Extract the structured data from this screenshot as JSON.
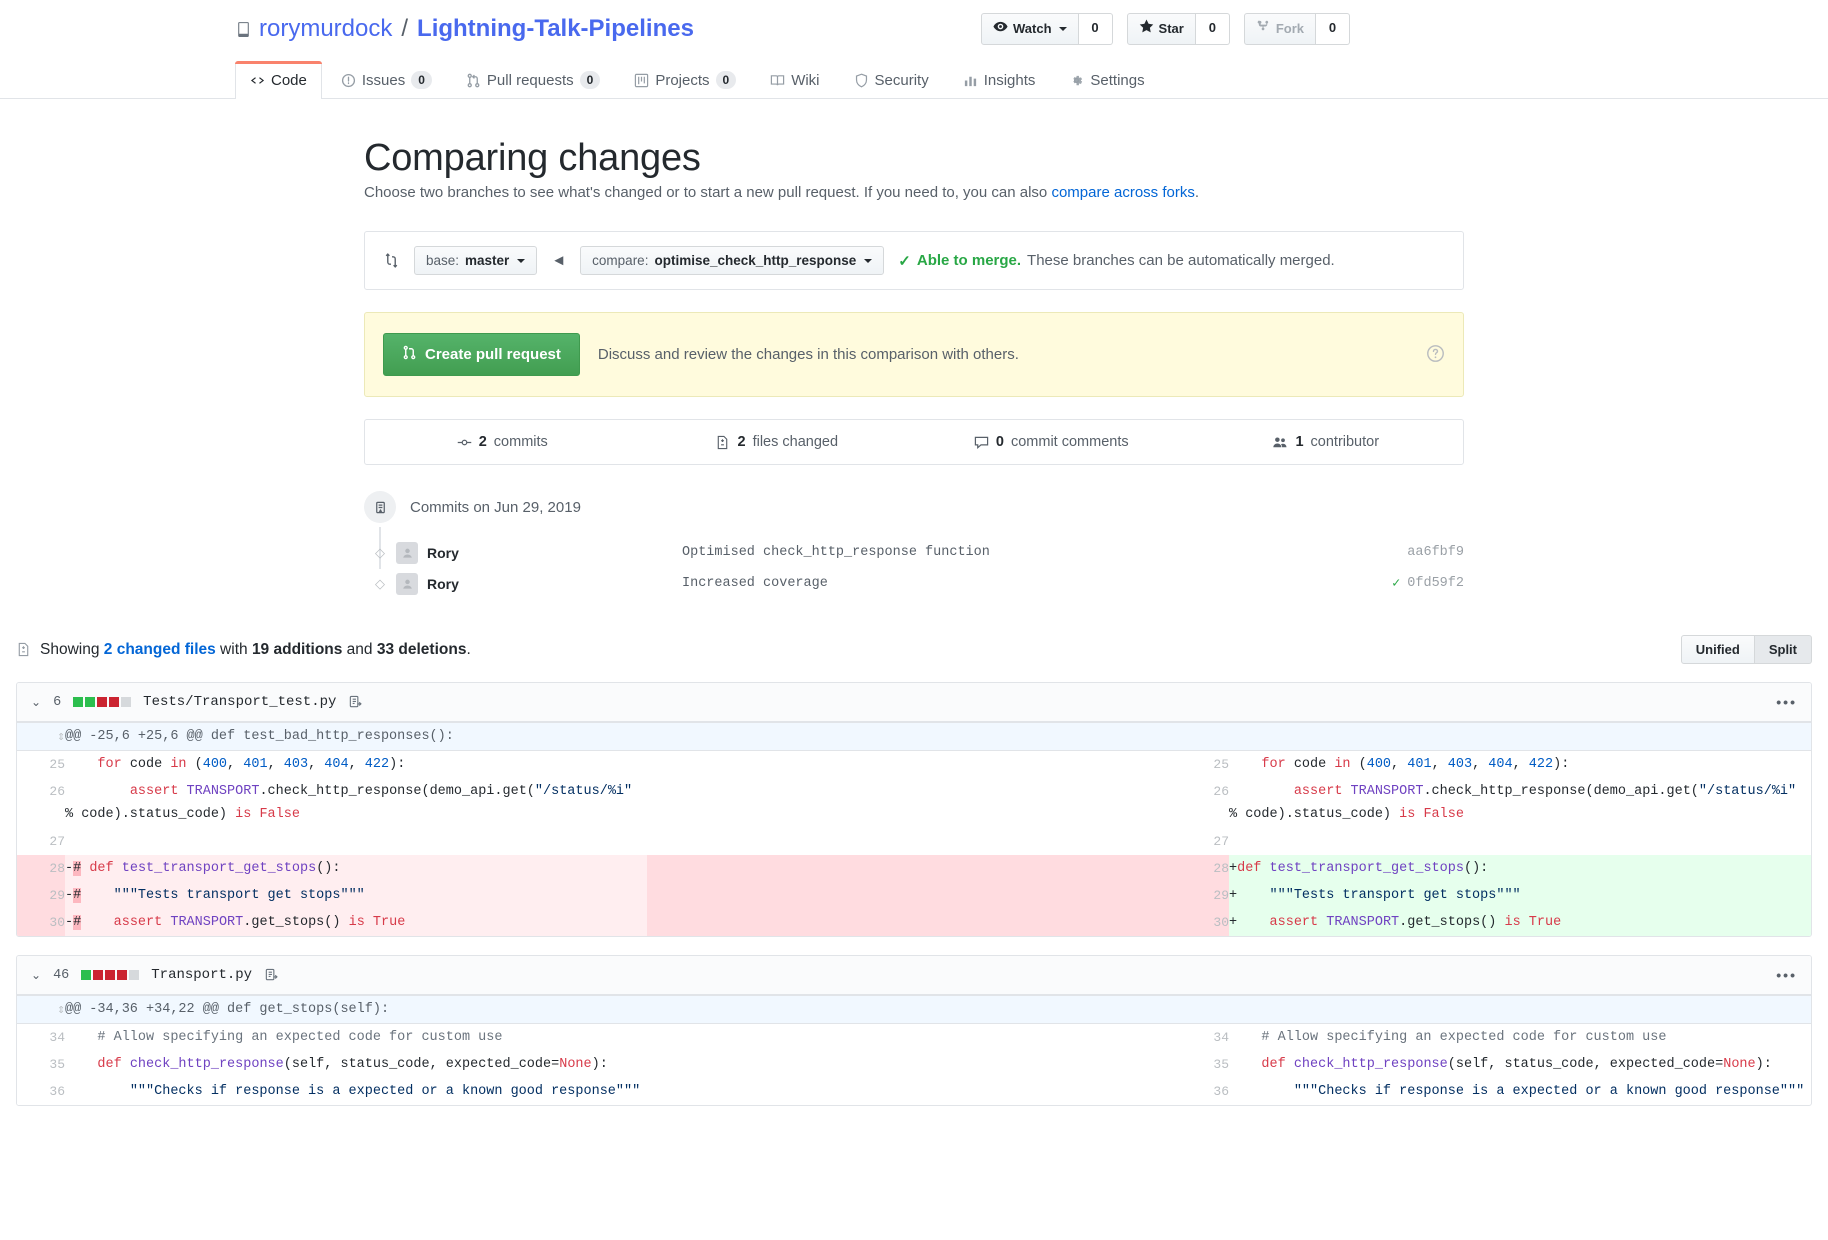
{
  "repo": {
    "owner": "rorymurdock",
    "name": "Lightning-Talk-Pipelines",
    "separator": "/"
  },
  "header_actions": [
    {
      "label": "Watch",
      "count": "0",
      "icon": "eye-icon",
      "has_caret": true,
      "disabled": false
    },
    {
      "label": "Star",
      "count": "0",
      "icon": "star-icon",
      "has_caret": false,
      "disabled": false
    },
    {
      "label": "Fork",
      "count": "0",
      "icon": "fork-icon",
      "has_caret": false,
      "disabled": true
    }
  ],
  "nav_tabs": [
    {
      "label": "Code",
      "icon": "code-icon",
      "count": null,
      "active": true
    },
    {
      "label": "Issues",
      "icon": "issue-opened-icon",
      "count": "0",
      "active": false
    },
    {
      "label": "Pull requests",
      "icon": "git-pull-request-icon",
      "count": "0",
      "active": false
    },
    {
      "label": "Projects",
      "icon": "project-icon",
      "count": "0",
      "active": false
    },
    {
      "label": "Wiki",
      "icon": "book-icon",
      "count": null,
      "active": false
    },
    {
      "label": "Security",
      "icon": "shield-icon",
      "count": null,
      "active": false
    },
    {
      "label": "Insights",
      "icon": "graph-icon",
      "count": null,
      "active": false
    },
    {
      "label": "Settings",
      "icon": "gear-icon",
      "count": null,
      "active": false
    }
  ],
  "page": {
    "title": "Comparing changes",
    "subtitle_before": "Choose two branches to see what's changed or to start a new pull request. If you need to, you can also ",
    "subtitle_link": "compare across forks",
    "subtitle_after": "."
  },
  "compare": {
    "base_prefix": "base: ",
    "base_branch": "master",
    "compare_prefix": "compare: ",
    "compare_branch": "optimise_check_http_response",
    "merge_status_bold": "Able to merge.",
    "merge_status_rest": "These branches can be automatically merged."
  },
  "pr_banner": {
    "button_label": "Create pull request",
    "description": "Discuss and review the changes in this comparison with others."
  },
  "stats": [
    {
      "count": "2",
      "label": "commits",
      "icon": "commit-icon"
    },
    {
      "count": "2",
      "label": "files changed",
      "icon": "file-diff-icon"
    },
    {
      "count": "0",
      "label": "commit comments",
      "icon": "comment-icon"
    },
    {
      "count": "1",
      "label": "contributor",
      "icon": "people-icon"
    }
  ],
  "commits": {
    "date_heading": "Commits on Jun 29, 2019",
    "rows": [
      {
        "author": "Rory",
        "message": "Optimised check_http_response function",
        "sha": "aa6fbf9",
        "has_check": false
      },
      {
        "author": "Rory",
        "message": "Increased coverage",
        "sha": "0fd59f2",
        "has_check": true
      }
    ]
  },
  "showing": {
    "prefix": "Showing ",
    "files_link": "2 changed files",
    "mid": " with ",
    "additions": "19 additions",
    "and": " and ",
    "deletions": "33 deletions",
    "suffix": ".",
    "view_unified": "Unified",
    "view_split": "Split",
    "active_view": "Split"
  },
  "diff_files": [
    {
      "change_count": "6",
      "filename": "Tests/Transport_test.py",
      "diffstat": [
        "a",
        "a",
        "d",
        "d",
        "n"
      ],
      "hunk_header": "@@ -25,6 +25,6 @@ def test_bad_http_responses():",
      "rows": [
        {
          "type": "context",
          "left_num": "25",
          "right_num": "25",
          "left_code": "    for code in (400, 401, 403, 404, 422):",
          "right_code": "    for code in (400, 401, 403, 404, 422):"
        },
        {
          "type": "context",
          "left_num": "26",
          "right_num": "26",
          "left_code": "        assert TRANSPORT.check_http_response(demo_api.get(\"/status/%i\" % code).status_code) is False",
          "right_code": "        assert TRANSPORT.check_http_response(demo_api.get(\"/status/%i\" % code).status_code) is False"
        },
        {
          "type": "context",
          "left_num": "27",
          "right_num": "27",
          "left_code": "",
          "right_code": ""
        },
        {
          "type": "change",
          "left_num": "28",
          "right_num": "28",
          "left_marker": "-",
          "right_marker": "+",
          "left_comment": "#",
          "left_code": " def test_transport_get_stops():",
          "right_code": "def test_transport_get_stops():"
        },
        {
          "type": "change",
          "left_num": "29",
          "right_num": "29",
          "left_marker": "-",
          "right_marker": "+",
          "left_comment": "#",
          "left_code": "    \"\"\"Tests transport get stops\"\"\"",
          "right_code": "    \"\"\"Tests transport get stops\"\"\""
        },
        {
          "type": "change",
          "left_num": "30",
          "right_num": "30",
          "left_marker": "-",
          "right_marker": "+",
          "left_comment": "#",
          "left_code": "    assert TRANSPORT.get_stops() is True",
          "right_code": "    assert TRANSPORT.get_stops() is True"
        }
      ]
    },
    {
      "change_count": "46",
      "filename": "Transport.py",
      "diffstat": [
        "a",
        "d",
        "d",
        "d",
        "n"
      ],
      "hunk_header": "@@ -34,36 +34,22 @@ def get_stops(self):",
      "rows": [
        {
          "type": "context",
          "left_num": "34",
          "right_num": "34",
          "left_code": "    # Allow specifying an expected code for custom use",
          "right_code": "    # Allow specifying an expected code for custom use"
        },
        {
          "type": "context",
          "left_num": "35",
          "right_num": "35",
          "left_code": "    def check_http_response(self, status_code, expected_code=None):",
          "right_code": "    def check_http_response(self, status_code, expected_code=None):"
        },
        {
          "type": "context",
          "left_num": "36",
          "right_num": "36",
          "left_code": "        \"\"\"Checks if response is a expected or a known good response\"\"\"",
          "right_code": "        \"\"\"Checks if response is a expected or a known good response\"\"\""
        }
      ]
    }
  ]
}
